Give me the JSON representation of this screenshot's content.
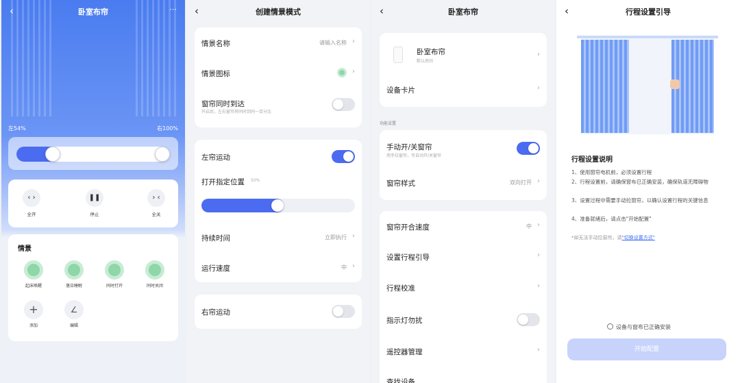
{
  "panel1": {
    "title": "卧室布帘",
    "left_label": "左54%",
    "right_label": "右100%",
    "left_value": 0.54,
    "right_value": 1.0,
    "controls": [
      "全开",
      "停止",
      "全关"
    ],
    "scene_title": "情景",
    "scenes": [
      "起床唤醒",
      "落日睡眠",
      "同时打开",
      "同时关闭"
    ],
    "extras": [
      "添加",
      "编辑"
    ]
  },
  "panel2": {
    "title": "创建情景模式",
    "name_label": "情景名称",
    "name_placeholder": "请输入名称",
    "icon_label": "情景图标",
    "sync_label": "窗帘同时到达",
    "sync_sub": "开启后，左右窗帘将同时到同一百分比",
    "left_motion_label": "左帘运动",
    "position_label": "打开指定位置",
    "position_value": "50%",
    "position_fraction": 0.5,
    "duration_label": "持续时间",
    "duration_value": "立即执行",
    "speed_label": "运行速度",
    "speed_value": "中",
    "right_motion_label": "右帘运动"
  },
  "panel3": {
    "title": "卧室布帘",
    "device_name": "卧室布帘",
    "device_sub": "默认房间",
    "card_label": "设备卡片",
    "section_label": "功能设置",
    "manual_label": "手动开/关窗帘",
    "manual_sub": "用手拉窗帘，可自动开/关窗帘",
    "style_label": "窗帘样式",
    "style_value": "双向打开",
    "speed_label": "窗帘开合速度",
    "speed_value": "中",
    "route_label": "设置行程引导",
    "calib_label": "行程校准",
    "led_label": "指示灯勿扰",
    "remote_label": "遥控器管理",
    "share_label": "查找设备"
  },
  "panel4": {
    "title": "行程设置引导",
    "heading": "行程设置说明",
    "steps": [
      "1、使用窗帘电机前，必须设置行程",
      "2、行程设置前，请确保窗布已正确安装，确保轨道无障碍物",
      "3、设置过程中需要手动拉窗帘，以确认设置行程的关键信息",
      "4、准备就绪后，请点击\"开始配置\""
    ],
    "note_prefix": "*如无法手动拉窗帘，请",
    "note_link": "\"切换设置方式\"",
    "confirm_label": "设备与窗布已正确安装",
    "start_button": "开始配置"
  }
}
